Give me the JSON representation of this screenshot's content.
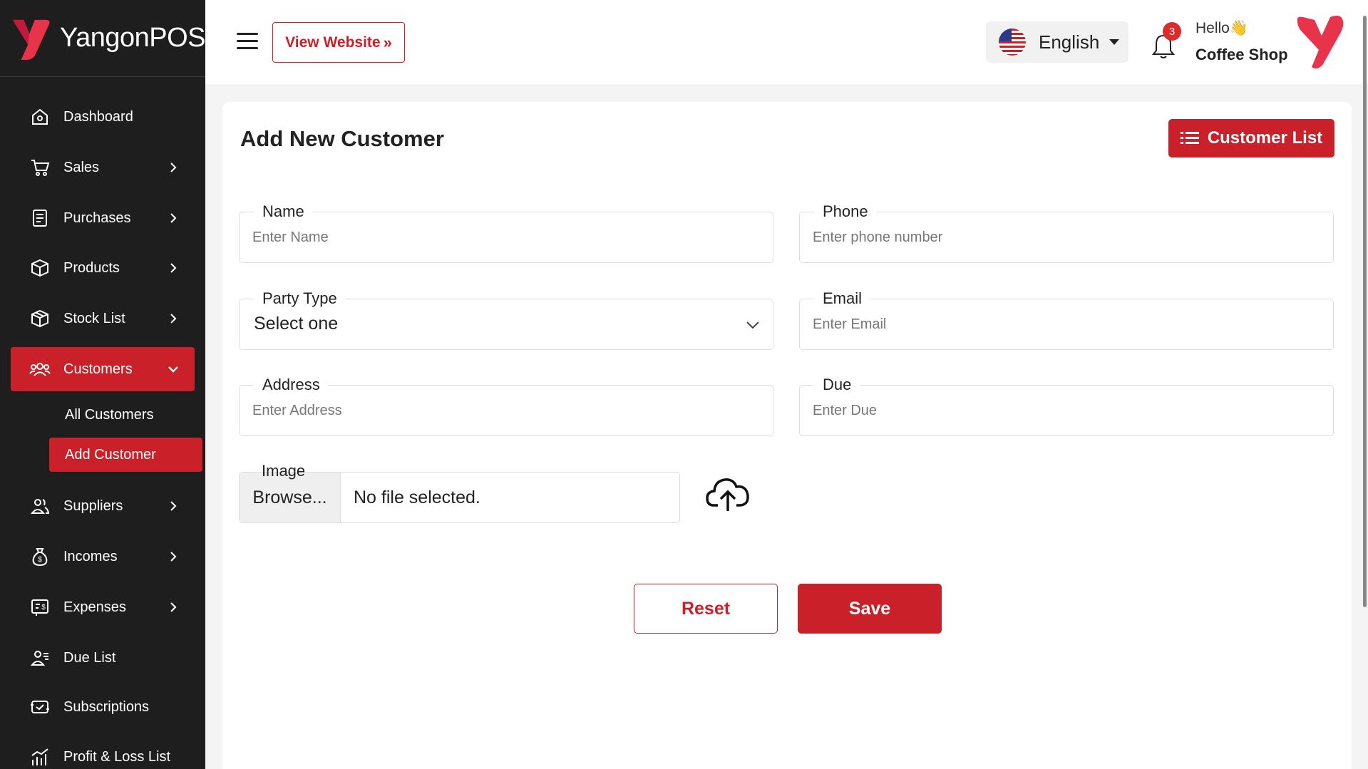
{
  "brand": {
    "name": "YangonPOS"
  },
  "sidebar": {
    "items": [
      {
        "label": "Dashboard",
        "icon": "home-icon"
      },
      {
        "label": "Sales",
        "icon": "cart-icon"
      },
      {
        "label": "Purchases",
        "icon": "receipt-icon"
      },
      {
        "label": "Products",
        "icon": "box-icon"
      },
      {
        "label": "Stock List",
        "icon": "package-icon"
      },
      {
        "label": "Customers",
        "icon": "users-icon",
        "active": true
      },
      {
        "label": "Suppliers",
        "icon": "user-group-icon"
      },
      {
        "label": "Incomes",
        "icon": "money-bag-icon"
      },
      {
        "label": "Expenses",
        "icon": "bill-icon"
      },
      {
        "label": "Due List",
        "icon": "user-list-icon"
      },
      {
        "label": "Subscriptions",
        "icon": "subscription-icon"
      },
      {
        "label": "Profit & Loss List",
        "icon": "chart-icon"
      }
    ],
    "customers_sub": [
      {
        "label": "All Customers"
      },
      {
        "label": "Add Customer",
        "active": true
      }
    ]
  },
  "header": {
    "view_website": "View Website",
    "language": "English",
    "notification_count": "3",
    "greeting": "Hello👋",
    "shop_name": "Coffee Shop"
  },
  "page": {
    "title": "Add New Customer",
    "customer_list_button": "Customer List"
  },
  "form": {
    "name": {
      "label": "Name",
      "placeholder": "Enter Name"
    },
    "phone": {
      "label": "Phone",
      "placeholder": "Enter phone number"
    },
    "party_type": {
      "label": "Party Type",
      "value": "Select one"
    },
    "email": {
      "label": "Email",
      "placeholder": "Enter Email"
    },
    "address": {
      "label": "Address",
      "placeholder": "Enter Address"
    },
    "due": {
      "label": "Due",
      "placeholder": "Enter Due"
    },
    "image": {
      "label": "Image",
      "browse": "Browse...",
      "file_status": "No file selected."
    },
    "reset": "Reset",
    "save": "Save"
  },
  "colors": {
    "accent": "#c9202a",
    "sidebar_bg": "#1e1e1e"
  }
}
